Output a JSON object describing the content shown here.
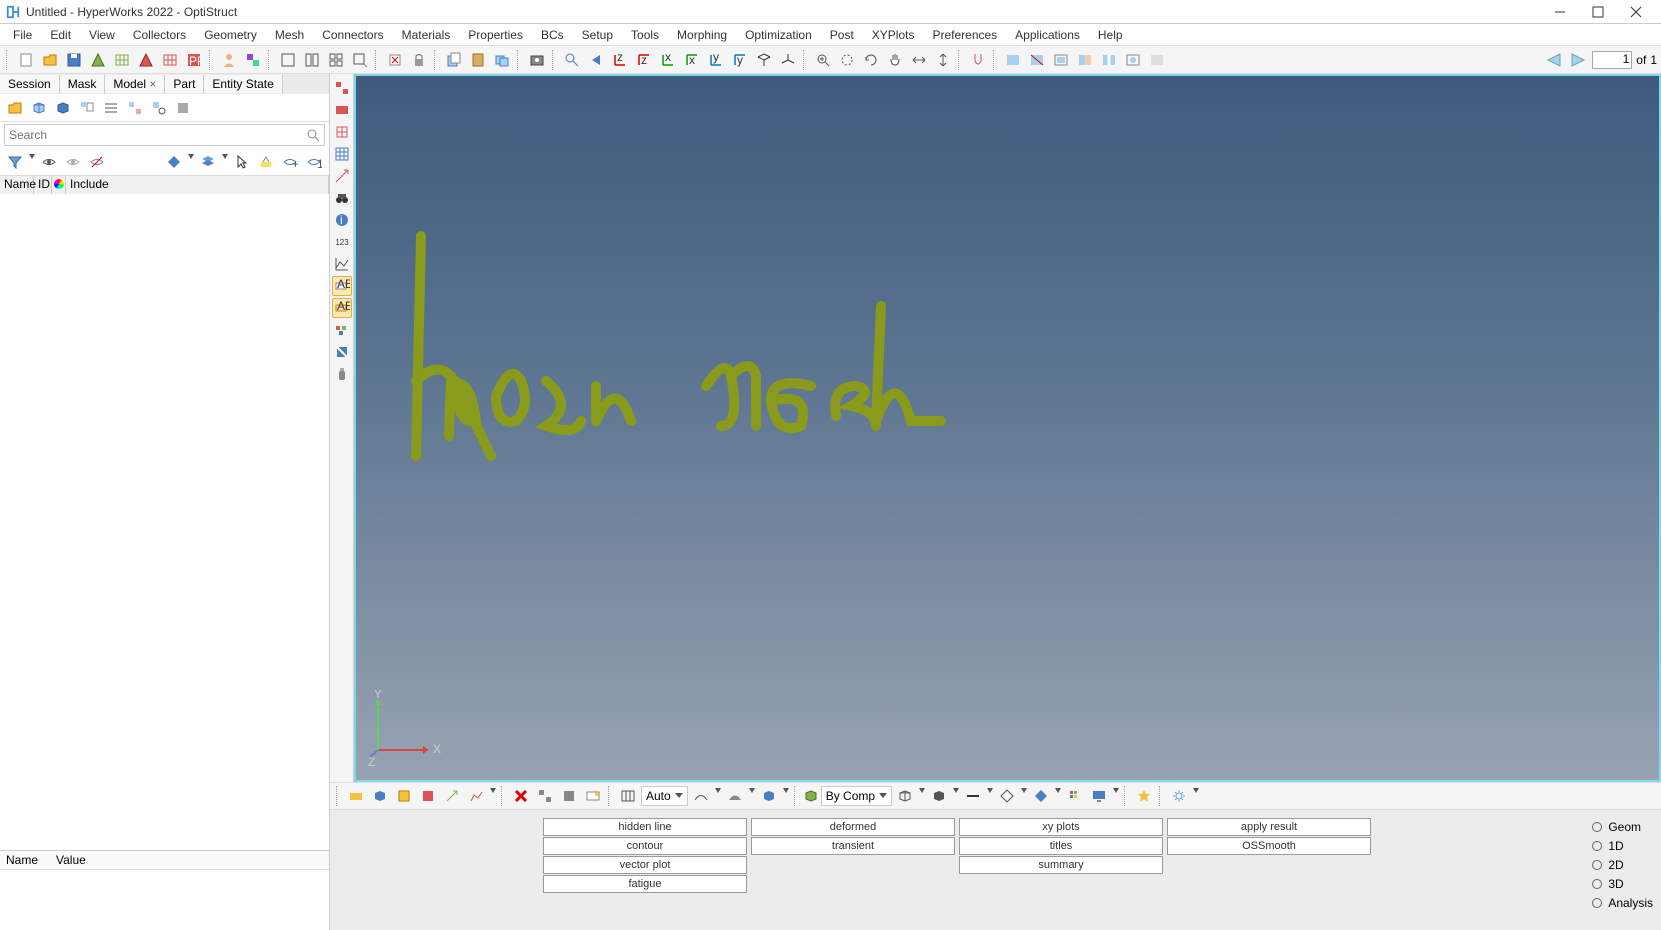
{
  "title": "Untitled - HyperWorks 2022 - OptiStruct",
  "menus": [
    "File",
    "Edit",
    "View",
    "Collectors",
    "Geometry",
    "Mesh",
    "Connectors",
    "Materials",
    "Properties",
    "BCs",
    "Setup",
    "Tools",
    "Morphing",
    "Optimization",
    "Post",
    "XYPlots",
    "Preferences",
    "Applications",
    "Help"
  ],
  "sidebar_tabs": {
    "session": "Session",
    "mask": "Mask",
    "model": "Model",
    "part": "Part",
    "entity": "Entity State"
  },
  "search_placeholder": "Search",
  "tree_headers": {
    "name": "Name",
    "id": "ID",
    "color": "",
    "include": "Include"
  },
  "props_headers": {
    "name": "Name",
    "value": "Value"
  },
  "bottom_labels": {
    "auto": "Auto",
    "bycomp": "By Comp"
  },
  "panel": {
    "col1": [
      "hidden line",
      "contour",
      "vector plot",
      "fatigue"
    ],
    "col2": [
      "deformed",
      "transient"
    ],
    "col3": [
      "xy plots",
      "titles",
      "summary"
    ],
    "col4": [
      "apply result",
      "OSSmooth"
    ]
  },
  "pages": [
    "Geom",
    "1D",
    "2D",
    "3D",
    "Analysis"
  ],
  "pager": {
    "current": "1",
    "of_label": "of",
    "total": "1"
  },
  "annotation_text": "Hyper mesh",
  "axes": {
    "x": "X",
    "y": "Y",
    "z": "Z"
  }
}
